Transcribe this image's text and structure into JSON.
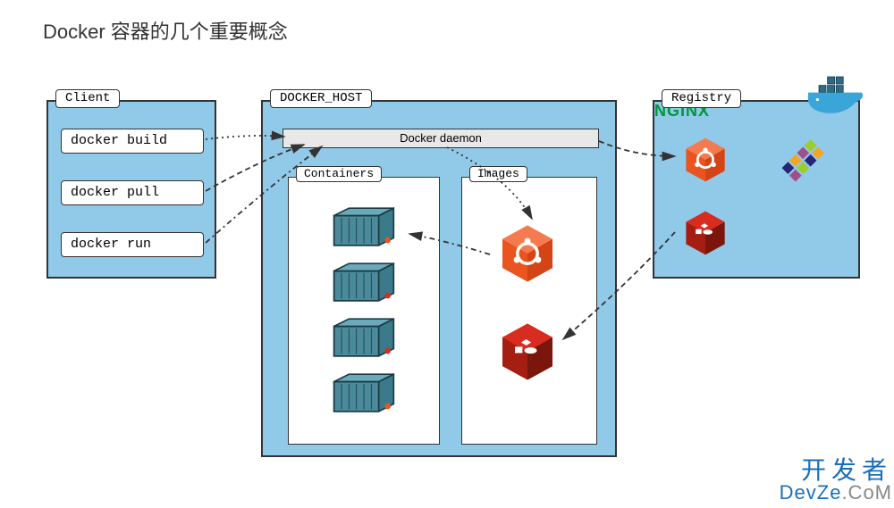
{
  "title": "Docker 容器的几个重要概念",
  "client": {
    "label": "Client",
    "commands": {
      "build": "docker build",
      "pull": "docker pull",
      "run": "docker run"
    }
  },
  "host": {
    "label": "DOCKER_HOST",
    "daemon": "Docker daemon",
    "containers_label": "Containers",
    "images_label": "Images"
  },
  "registry": {
    "label": "Registry",
    "nginx_text": "NGINX"
  },
  "watermark": {
    "cn": "开发者",
    "en_prefix": "DevZe",
    "en_suffix": ".CoM"
  }
}
